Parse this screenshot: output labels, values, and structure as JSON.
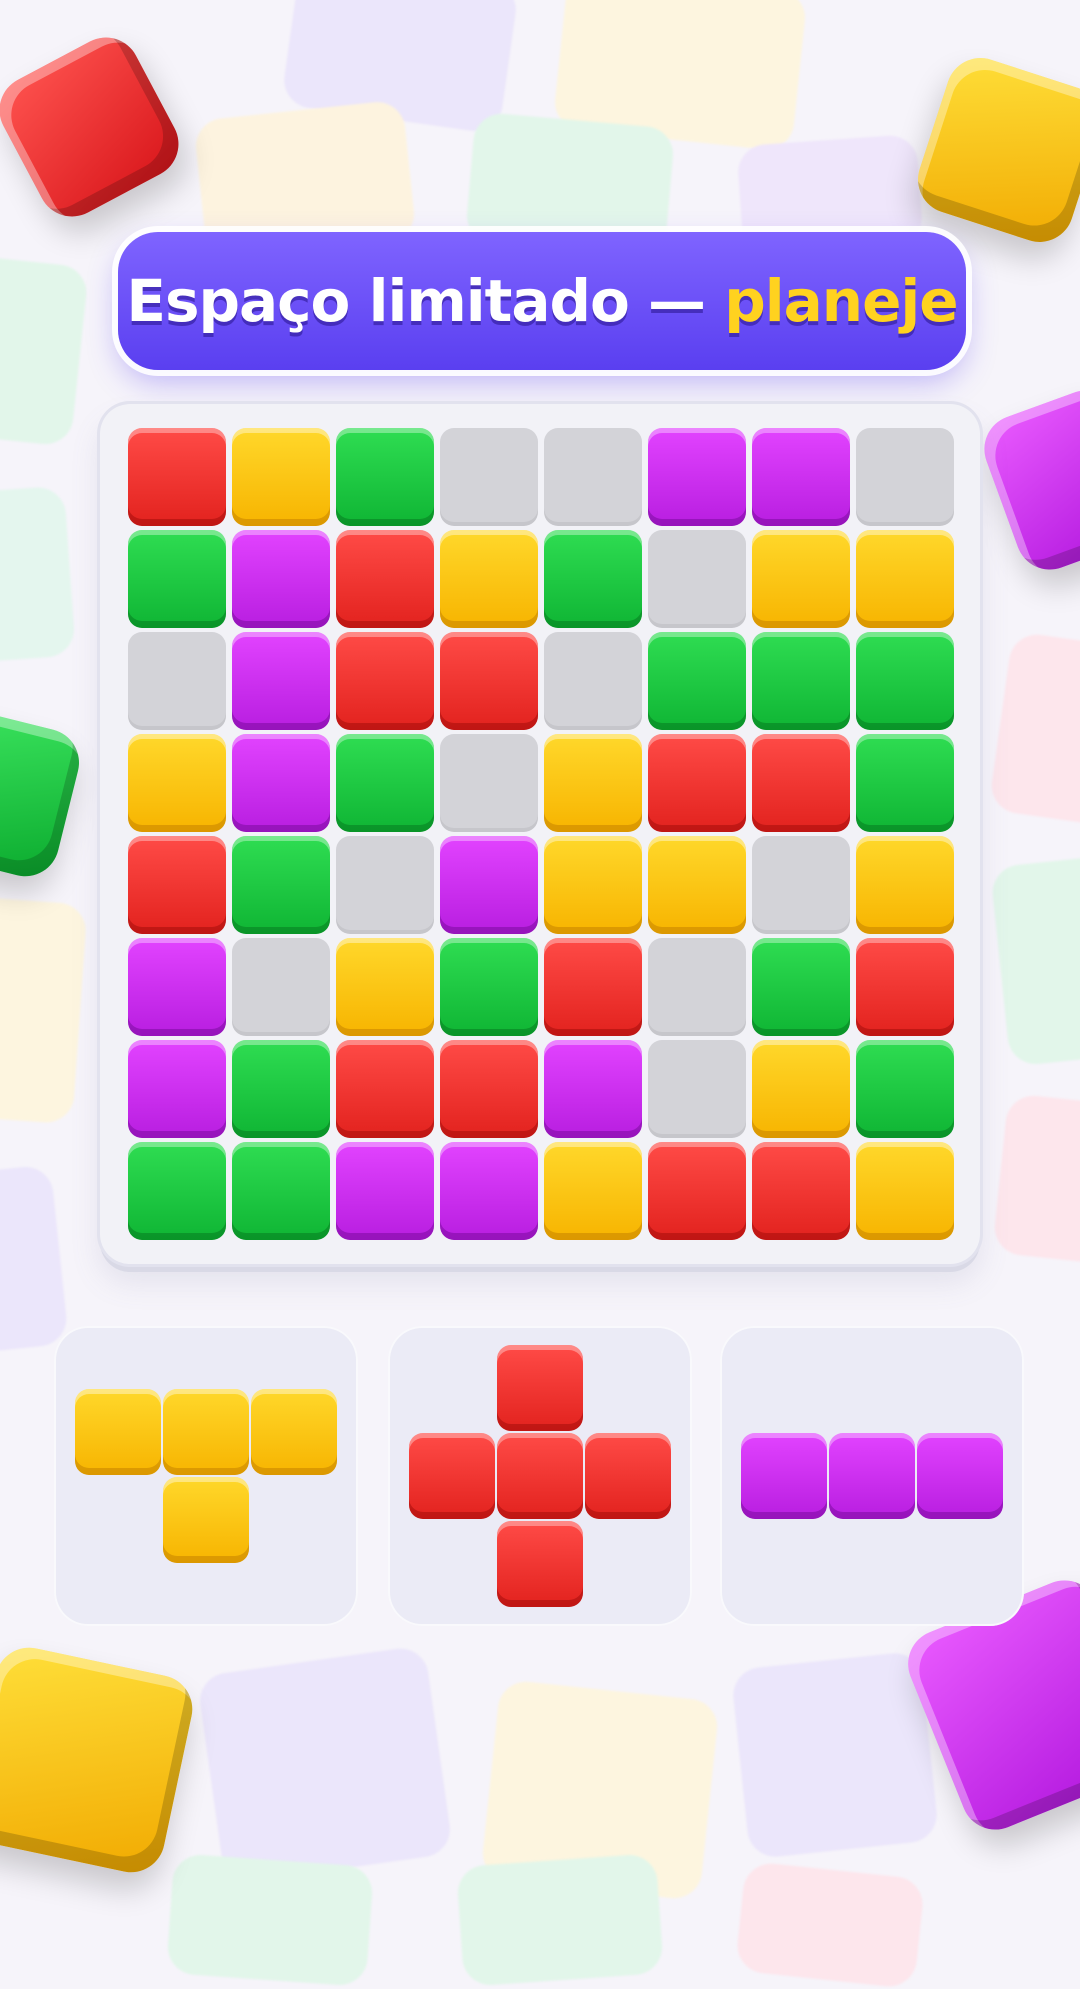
{
  "title": {
    "main": "Espaço limitado — ",
    "highlight": "planeje"
  },
  "board": {
    "rows": [
      [
        "R",
        "Y",
        "G",
        "E",
        "E",
        "P",
        "P",
        "E"
      ],
      [
        "G",
        "P",
        "R",
        "Y",
        "G",
        "E",
        "Y",
        "Y"
      ],
      [
        "E",
        "P",
        "R",
        "R",
        "E",
        "G",
        "G",
        "G"
      ],
      [
        "Y",
        "P",
        "G",
        "E",
        "Y",
        "R",
        "R",
        "G"
      ],
      [
        "R",
        "G",
        "E",
        "P",
        "Y",
        "Y",
        "E",
        "Y"
      ],
      [
        "P",
        "E",
        "Y",
        "G",
        "R",
        "E",
        "G",
        "R"
      ],
      [
        "P",
        "G",
        "R",
        "R",
        "P",
        "E",
        "Y",
        "G"
      ],
      [
        "G",
        "G",
        "P",
        "P",
        "Y",
        "R",
        "R",
        "Y"
      ]
    ],
    "legend": {
      "R": "red",
      "Y": "yellow",
      "G": "green",
      "P": "purple",
      "E": "empty"
    }
  },
  "pieces": [
    {
      "name": "t-piece",
      "color": "Y",
      "shape": [
        [
          1,
          1,
          1
        ],
        [
          0,
          1,
          0
        ]
      ]
    },
    {
      "name": "plus-piece",
      "color": "R",
      "shape": [
        [
          0,
          1,
          0
        ],
        [
          1,
          1,
          1
        ],
        [
          0,
          1,
          0
        ]
      ]
    },
    {
      "name": "line-piece",
      "color": "P",
      "shape": [
        [
          1,
          1,
          1
        ]
      ]
    }
  ],
  "colors": {
    "red": "#e2221e",
    "yellow": "#f7b400",
    "green": "#0fb534",
    "purple": "#b81ee0",
    "empty": "#d3d3d8",
    "banner": "#5a3ff0",
    "highlight": "#ffd21f"
  }
}
